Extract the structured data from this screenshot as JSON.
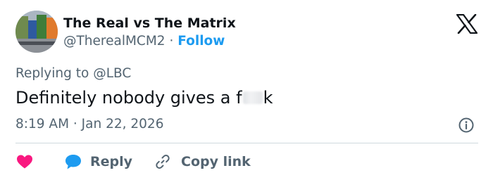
{
  "author": {
    "display_name": "The Real vs The Matrix",
    "handle": "@TherealMCM2",
    "separator": "·",
    "follow_label": "Follow"
  },
  "reply_context": {
    "prefix": "Replying to",
    "mention": "@LBC"
  },
  "tweet": {
    "text_before": "Definitely nobody gives a f",
    "text_after": "k",
    "timestamp": "8:19 AM · Jan 22, 2026"
  },
  "actions": {
    "reply_label": "Reply",
    "copy_link_label": "Copy link"
  },
  "icons": {
    "like": "heart-icon",
    "reply": "speech-bubble-icon",
    "copy_link": "link-icon",
    "info": "info-icon",
    "brand": "x-logo-icon"
  },
  "colors": {
    "accent": "#1d9bf0",
    "like": "#f91880",
    "secondary_text": "#536471",
    "primary_text": "#0f1419",
    "divider": "#cfd9de"
  }
}
